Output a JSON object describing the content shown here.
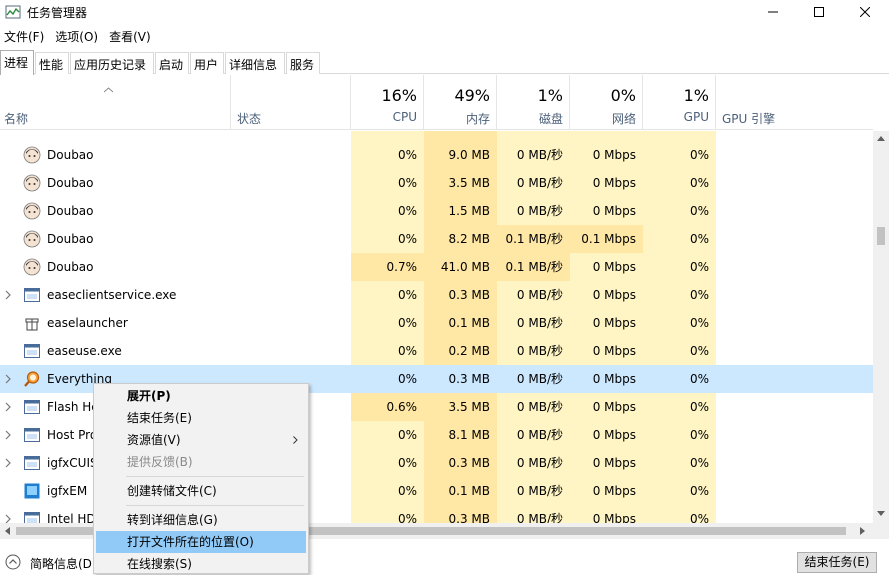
{
  "window": {
    "title": "任务管理器"
  },
  "menu": [
    "文件(F)",
    "选项(O)",
    "查看(V)"
  ],
  "tabs": [
    "进程",
    "性能",
    "应用历史记录",
    "启动",
    "用户",
    "详细信息",
    "服务"
  ],
  "columns": {
    "name": "名称",
    "status": "状态",
    "cpu": {
      "pct": "16%",
      "label": "CPU"
    },
    "mem": {
      "pct": "49%",
      "label": "内存"
    },
    "disk": {
      "pct": "1%",
      "label": "磁盘"
    },
    "net": {
      "pct": "0%",
      "label": "网络"
    },
    "gpu": {
      "pct": "1%",
      "label": "GPU"
    },
    "gpu_engine": "GPU 引擎"
  },
  "rows": [
    {
      "name": "Doubao",
      "cpu": "0%",
      "mem": "9.0 MB",
      "disk": "0 MB/秒",
      "net": "0 Mbps",
      "gpu": "0%"
    },
    {
      "name": "Doubao",
      "cpu": "0%",
      "mem": "3.5 MB",
      "disk": "0 MB/秒",
      "net": "0 Mbps",
      "gpu": "0%"
    },
    {
      "name": "Doubao",
      "cpu": "0%",
      "mem": "1.5 MB",
      "disk": "0 MB/秒",
      "net": "0 Mbps",
      "gpu": "0%"
    },
    {
      "name": "Doubao",
      "cpu": "0%",
      "mem": "8.2 MB",
      "disk": "0.1 MB/秒",
      "net": "0.1 Mbps",
      "gpu": "0%"
    },
    {
      "name": "Doubao",
      "cpu": "0.7%",
      "mem": "41.0 MB",
      "disk": "0.1 MB/秒",
      "net": "0 Mbps",
      "gpu": "0%"
    },
    {
      "name": "easeclientservice.exe",
      "cpu": "0%",
      "mem": "0.3 MB",
      "disk": "0 MB/秒",
      "net": "0 Mbps",
      "gpu": "0%"
    },
    {
      "name": "easelauncher",
      "cpu": "0%",
      "mem": "0.1 MB",
      "disk": "0 MB/秒",
      "net": "0 Mbps",
      "gpu": "0%"
    },
    {
      "name": "easeuse.exe",
      "cpu": "0%",
      "mem": "0.2 MB",
      "disk": "0 MB/秒",
      "net": "0 Mbps",
      "gpu": "0%"
    },
    {
      "name": "Everything",
      "cpu": "0%",
      "mem": "0.3 MB",
      "disk": "0 MB/秒",
      "net": "0 Mbps",
      "gpu": "0%"
    },
    {
      "name": "Flash He",
      "cpu": "0.6%",
      "mem": "3.5 MB",
      "disk": "0 MB/秒",
      "net": "0 Mbps",
      "gpu": "0%"
    },
    {
      "name": "Host Pro",
      "cpu": "0%",
      "mem": "8.1 MB",
      "disk": "0 MB/秒",
      "net": "0 Mbps",
      "gpu": "0%"
    },
    {
      "name": "igfxCUIS",
      "cpu": "0%",
      "mem": "0.3 MB",
      "disk": "0 MB/秒",
      "net": "0 Mbps",
      "gpu": "0%"
    },
    {
      "name": "igfxEM",
      "cpu": "0%",
      "mem": "0.1 MB",
      "disk": "0 MB/秒",
      "net": "0 Mbps",
      "gpu": "0%"
    },
    {
      "name": "Intel HD",
      "cpu": "0%",
      "mem": "0.3 MB",
      "disk": "0 MB/秒",
      "net": "0 Mbps",
      "gpu": "0%"
    }
  ],
  "context_menu": {
    "expand": "展开(P)",
    "end_task": "结束任务(E)",
    "resource_values": "资源值(V)",
    "feedback": "提供反馈(B)",
    "create_dump": "创建转储文件(C)",
    "goto_details": "转到详细信息(G)",
    "open_location": "打开文件所在的位置(O)",
    "search_online": "在线搜索(S)"
  },
  "footer": {
    "less_details": "简略信息(D)",
    "end_task_button": "结束任务(E)"
  },
  "colors": {
    "heat_light": "#fff4c4",
    "heat_mid": "#ffe8a6",
    "selected": "#cce8ff",
    "menu_hover": "#91c9f7"
  }
}
